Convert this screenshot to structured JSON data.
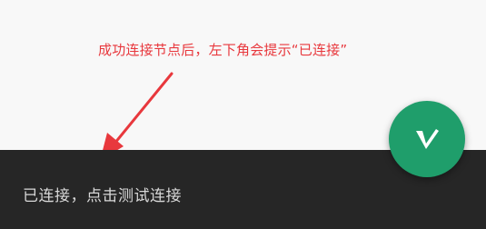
{
  "annotation": {
    "text": "成功连接节点后，左下角会提示“已连接”",
    "color": "#e8383d"
  },
  "snackbar": {
    "message": "已连接，点击测试连接",
    "background": "#262626"
  },
  "fab": {
    "icon": "v-logo-icon",
    "color": "#1f9e6b"
  }
}
